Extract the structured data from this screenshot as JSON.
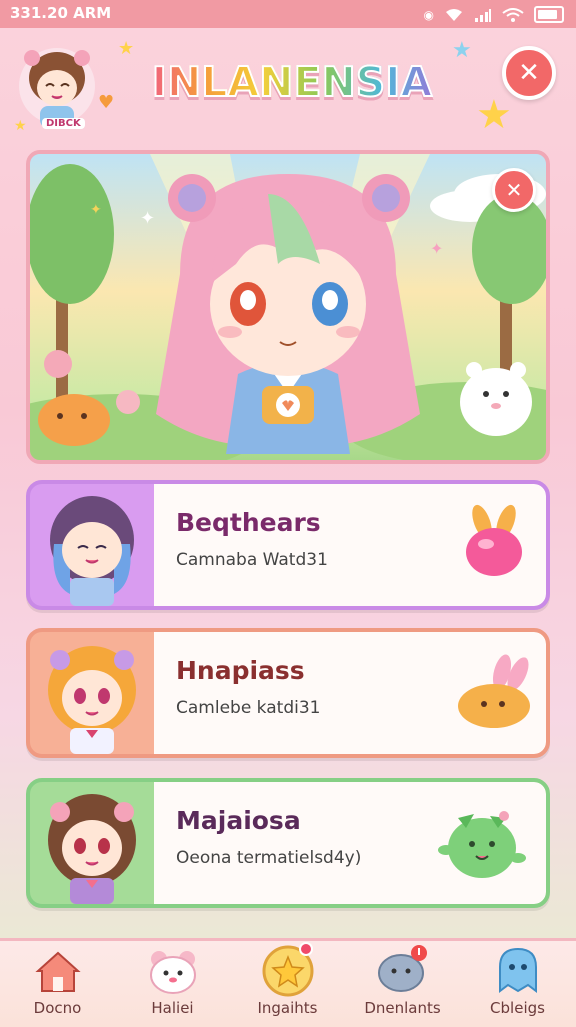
{
  "status_bar": {
    "time": "331.20 ARM"
  },
  "header": {
    "title": "INLANENSIA",
    "avatar_badge": "DIBCK"
  },
  "characters": [
    {
      "name": "Beqthears",
      "subtitle": "Camnaba Watd31",
      "accent": "#c98ae6"
    },
    {
      "name": "Hnapiass",
      "subtitle": "Camlebe katdi31",
      "accent": "#ef9a82"
    },
    {
      "name": "Majaiosa",
      "subtitle": "Oeona termatielsd4y)",
      "accent": "#86cf85"
    }
  ],
  "nav": {
    "items": [
      {
        "label": "Docno",
        "icon": "house-icon"
      },
      {
        "label": "Haliei",
        "icon": "bear-icon"
      },
      {
        "label": "Ingaihts",
        "icon": "star-icon",
        "badge": true
      },
      {
        "label": "Dnenlants",
        "icon": "chat-icon",
        "badge": true
      },
      {
        "label": "Cbleigs",
        "icon": "ghost-icon"
      }
    ]
  },
  "colors": {
    "status_bar": "#f19aa3",
    "close_button": "#f26868",
    "title_text": "#7a2a6a"
  }
}
